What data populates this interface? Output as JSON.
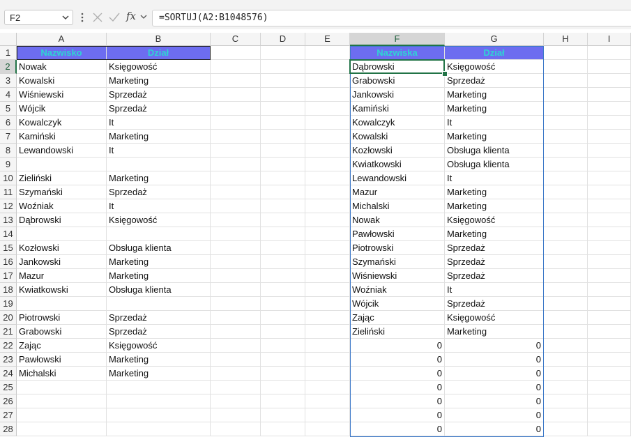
{
  "formula_bar": {
    "name_box": "F2",
    "fx_label": "fx",
    "formula": "=SORTUJ(A2:B1048576)"
  },
  "columns": [
    "A",
    "B",
    "C",
    "D",
    "E",
    "F",
    "G",
    "H",
    "I"
  ],
  "selected_column": "F",
  "selected_row": 2,
  "rows": [
    "1",
    "2",
    "3",
    "4",
    "5",
    "6",
    "7",
    "8",
    "9",
    "10",
    "11",
    "12",
    "13",
    "14",
    "15",
    "16",
    "17",
    "18",
    "19",
    "20",
    "21",
    "22",
    "23",
    "24",
    "25",
    "26",
    "27",
    "28"
  ],
  "headers": {
    "A1": "Nazwisko",
    "B1": "Dział",
    "F1": "Nazwiska",
    "G1": "Dział"
  },
  "source_table": [
    [
      "Nowak",
      "Księgowość"
    ],
    [
      "Kowalski",
      "Marketing"
    ],
    [
      "Wiśniewski",
      "Sprzedaż"
    ],
    [
      "Wójcik",
      "Sprzedaż"
    ],
    [
      "Kowalczyk",
      "It"
    ],
    [
      "Kamiński",
      "Marketing"
    ],
    [
      "Lewandowski",
      "It"
    ],
    [
      "",
      ""
    ],
    [
      "Zieliński",
      "Marketing"
    ],
    [
      "Szymański",
      "Sprzedaż"
    ],
    [
      "Woźniak",
      "It"
    ],
    [
      "Dąbrowski",
      "Księgowość"
    ],
    [
      "",
      ""
    ],
    [
      "Kozłowski",
      "Obsługa klienta"
    ],
    [
      "Jankowski",
      "Marketing"
    ],
    [
      "Mazur",
      "Marketing"
    ],
    [
      "Kwiatkowski",
      "Obsługa klienta"
    ],
    [
      "",
      ""
    ],
    [
      "Piotrowski",
      "Sprzedaż"
    ],
    [
      "Grabowski",
      "Sprzedaż"
    ],
    [
      "Zając",
      "Księgowość"
    ],
    [
      "Pawłowski",
      "Marketing"
    ],
    [
      "Michalski",
      "Marketing"
    ]
  ],
  "sorted_table": [
    [
      "Dąbrowski",
      "Księgowość"
    ],
    [
      "Grabowski",
      "Sprzedaż"
    ],
    [
      "Jankowski",
      "Marketing"
    ],
    [
      "Kamiński",
      "Marketing"
    ],
    [
      "Kowalczyk",
      "It"
    ],
    [
      "Kowalski",
      "Marketing"
    ],
    [
      "Kozłowski",
      "Obsługa klienta"
    ],
    [
      "Kwiatkowski",
      "Obsługa klienta"
    ],
    [
      "Lewandowski",
      "It"
    ],
    [
      "Mazur",
      "Marketing"
    ],
    [
      "Michalski",
      "Marketing"
    ],
    [
      "Nowak",
      "Księgowość"
    ],
    [
      "Pawłowski",
      "Marketing"
    ],
    [
      "Piotrowski",
      "Sprzedaż"
    ],
    [
      "Szymański",
      "Sprzedaż"
    ],
    [
      "Wiśniewski",
      "Sprzedaż"
    ],
    [
      "Woźniak",
      "It"
    ],
    [
      "Wójcik",
      "Sprzedaż"
    ],
    [
      "Zając",
      "Księgowość"
    ],
    [
      "Zieliński",
      "Marketing"
    ]
  ],
  "zero_value": "0",
  "colors": {
    "header_fill": "#6d6df0",
    "header_text": "#2fd3d3",
    "active_border": "#217346",
    "spill_border": "#3c78c8"
  },
  "icons": {
    "name_box_dropdown": "chevron-down-icon",
    "more": "vertical-dots-icon",
    "cancel": "cancel-x-icon",
    "enter": "checkmark-icon",
    "insert_function": "fx-icon",
    "expand": "chevron-down-icon"
  }
}
